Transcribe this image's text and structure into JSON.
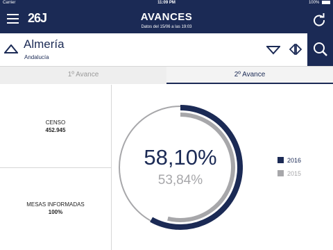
{
  "status": {
    "carrier": "Carrier",
    "time": "11:09 PM",
    "battery": "100%"
  },
  "header": {
    "logo": "26J",
    "title": "AVANCES",
    "subtitle": "Datos del 15/06 a las 19:03"
  },
  "location": {
    "name": "Almería",
    "region": "Andalucía"
  },
  "tabs": [
    {
      "label": "1º Avance",
      "active": false
    },
    {
      "label": "2º Avance",
      "active": true
    }
  ],
  "stats": {
    "censo_label": "CENSO",
    "censo_value": "452.945",
    "mesas_label": "MESAS INFORMADAS",
    "mesas_value": "100%"
  },
  "chart": {
    "current": {
      "label": "58,10%",
      "value": 58.1,
      "year": "2016",
      "color": "#1b2a55"
    },
    "previous": {
      "label": "53,84%",
      "value": 53.84,
      "year": "2015",
      "color": "#a7a7aa"
    }
  },
  "colors": {
    "accent": "#1b2a55",
    "secondary": "#a7a7aa"
  }
}
